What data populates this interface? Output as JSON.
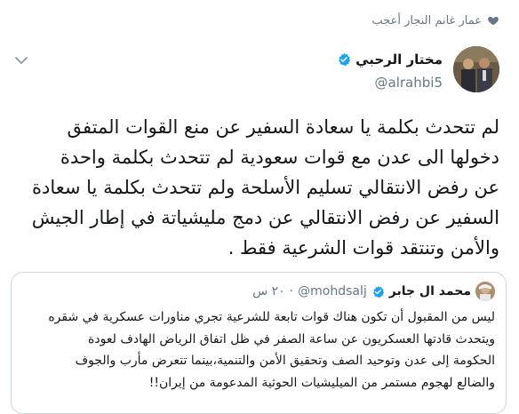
{
  "context": {
    "text": "عمار غانم النجار أعجب",
    "icon": "heart-icon"
  },
  "author": {
    "name": "مختار الرحبي",
    "handle": "@alrahbi5",
    "verified": true,
    "verified_color": "#1da1f2"
  },
  "tweet": {
    "lines": [
      "لم تتحدث بكلمة يا سعادة السفير عن منع القوات المتفق",
      "دخولها الى عدن مع قوات سعودية لم تتحدث بكلمة واحدة",
      "عن رفض الانتقالي تسليم الأسلحة ولم تتحدث بكلمة يا سعادة",
      "السفير عن رفض الانتقالي عن دمج مليشياتة في إطار الجيش",
      "والأمن وتنتقد قوات الشرعية فقط ."
    ]
  },
  "quote": {
    "name": "محمد ال جابر",
    "handle": "@mohdsalj",
    "time": "٢٠ س",
    "lines": [
      "ليس من المقبول أن تكون هناك قوات تابعة للشرعية تجري مناورات عسكرية في شقره",
      "ويتحدث قادتها العسكريون عن ساعة الصفر في ظل اتفاق الرياض الهادف لعودة",
      "الحكومة إلى عدن وتوحيد الصف وتحقيق الأمن والتنمية،بينما تتعرض مأرب والجوف",
      "والضالع لهجوم مستمر من الميليشيات الحوثية المدعومة من إيران!!"
    ]
  }
}
